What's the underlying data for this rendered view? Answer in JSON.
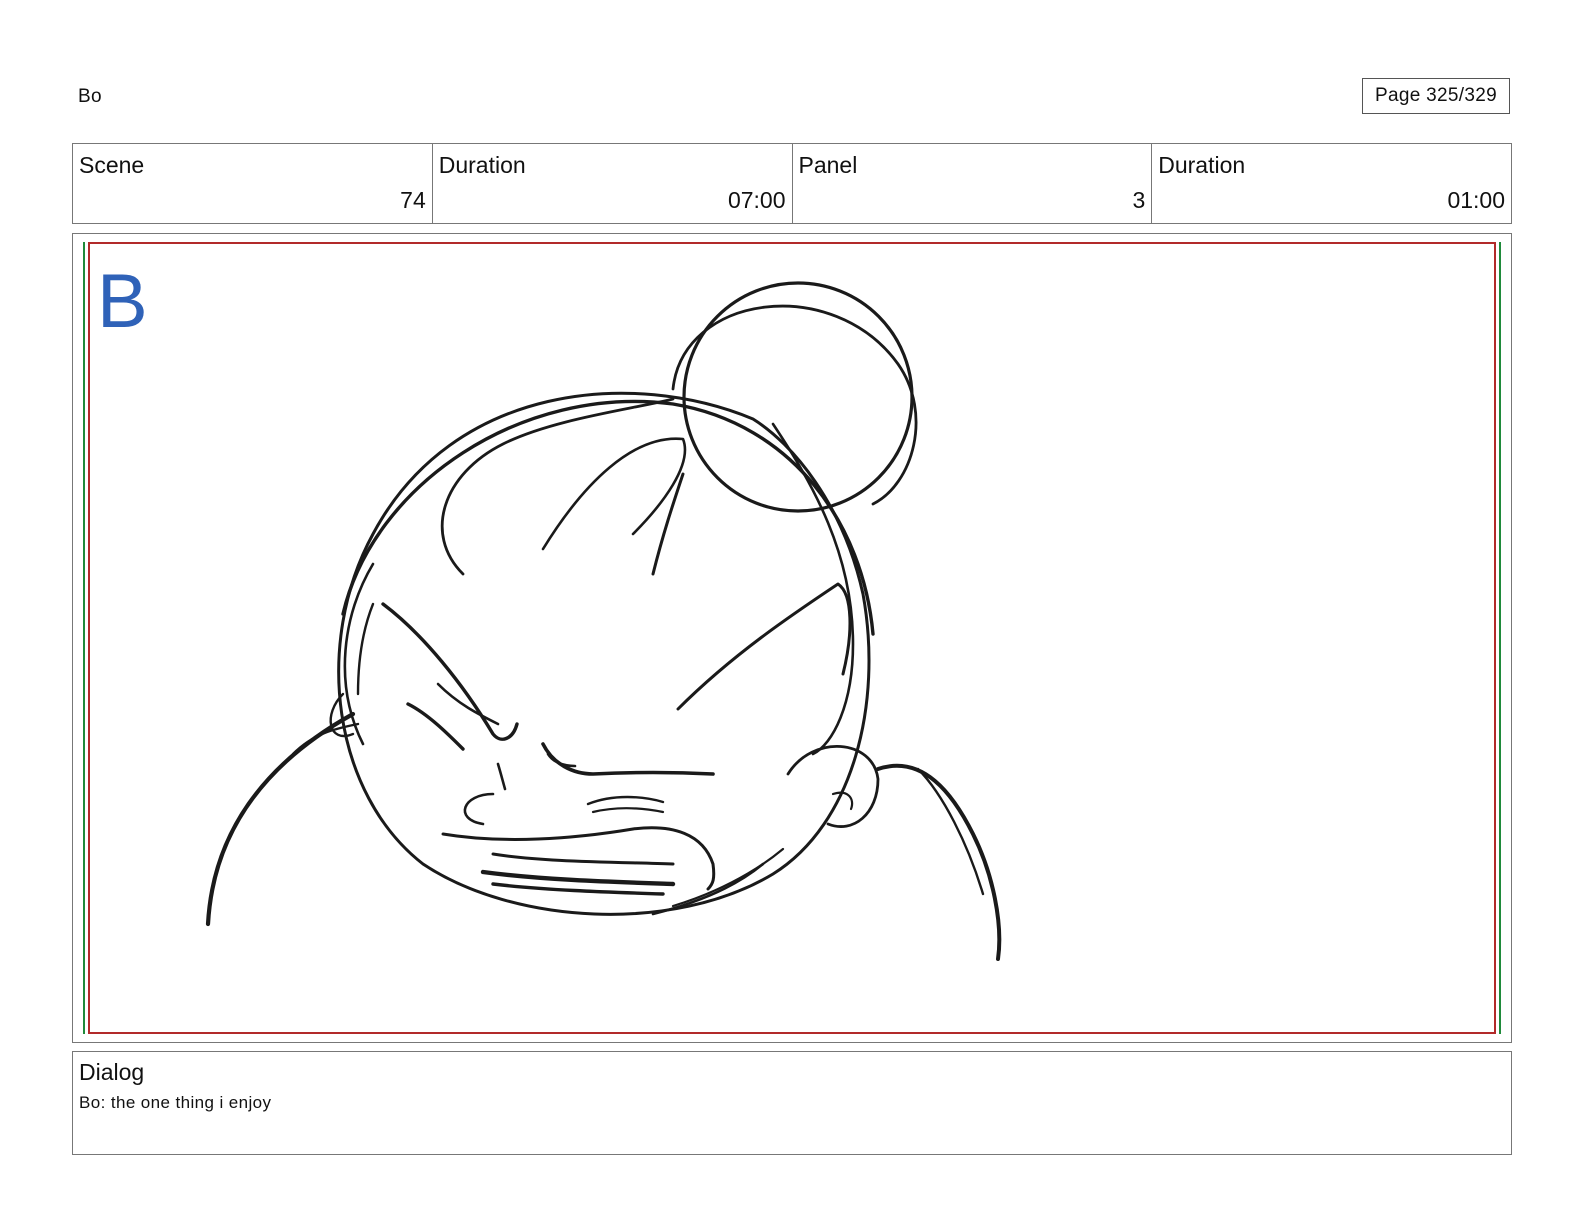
{
  "header": {
    "project": "Bo",
    "page": "Page 325/329"
  },
  "info": {
    "scene_label": "Scene",
    "scene_value": "74",
    "scene_duration_label": "Duration",
    "scene_duration_value": "07:00",
    "panel_label": "Panel",
    "panel_value": "3",
    "panel_duration_label": "Duration",
    "panel_duration_value": "01:00"
  },
  "panel": {
    "letter": "B",
    "letter_color": "#2f62b8",
    "safe_outer_color": "#1f8a3a",
    "safe_inner_color": "#b22a2a",
    "sketch": "pencil-sketch"
  },
  "dialog": {
    "label": "Dialog",
    "text": "Bo: the one thing i enjoy"
  }
}
